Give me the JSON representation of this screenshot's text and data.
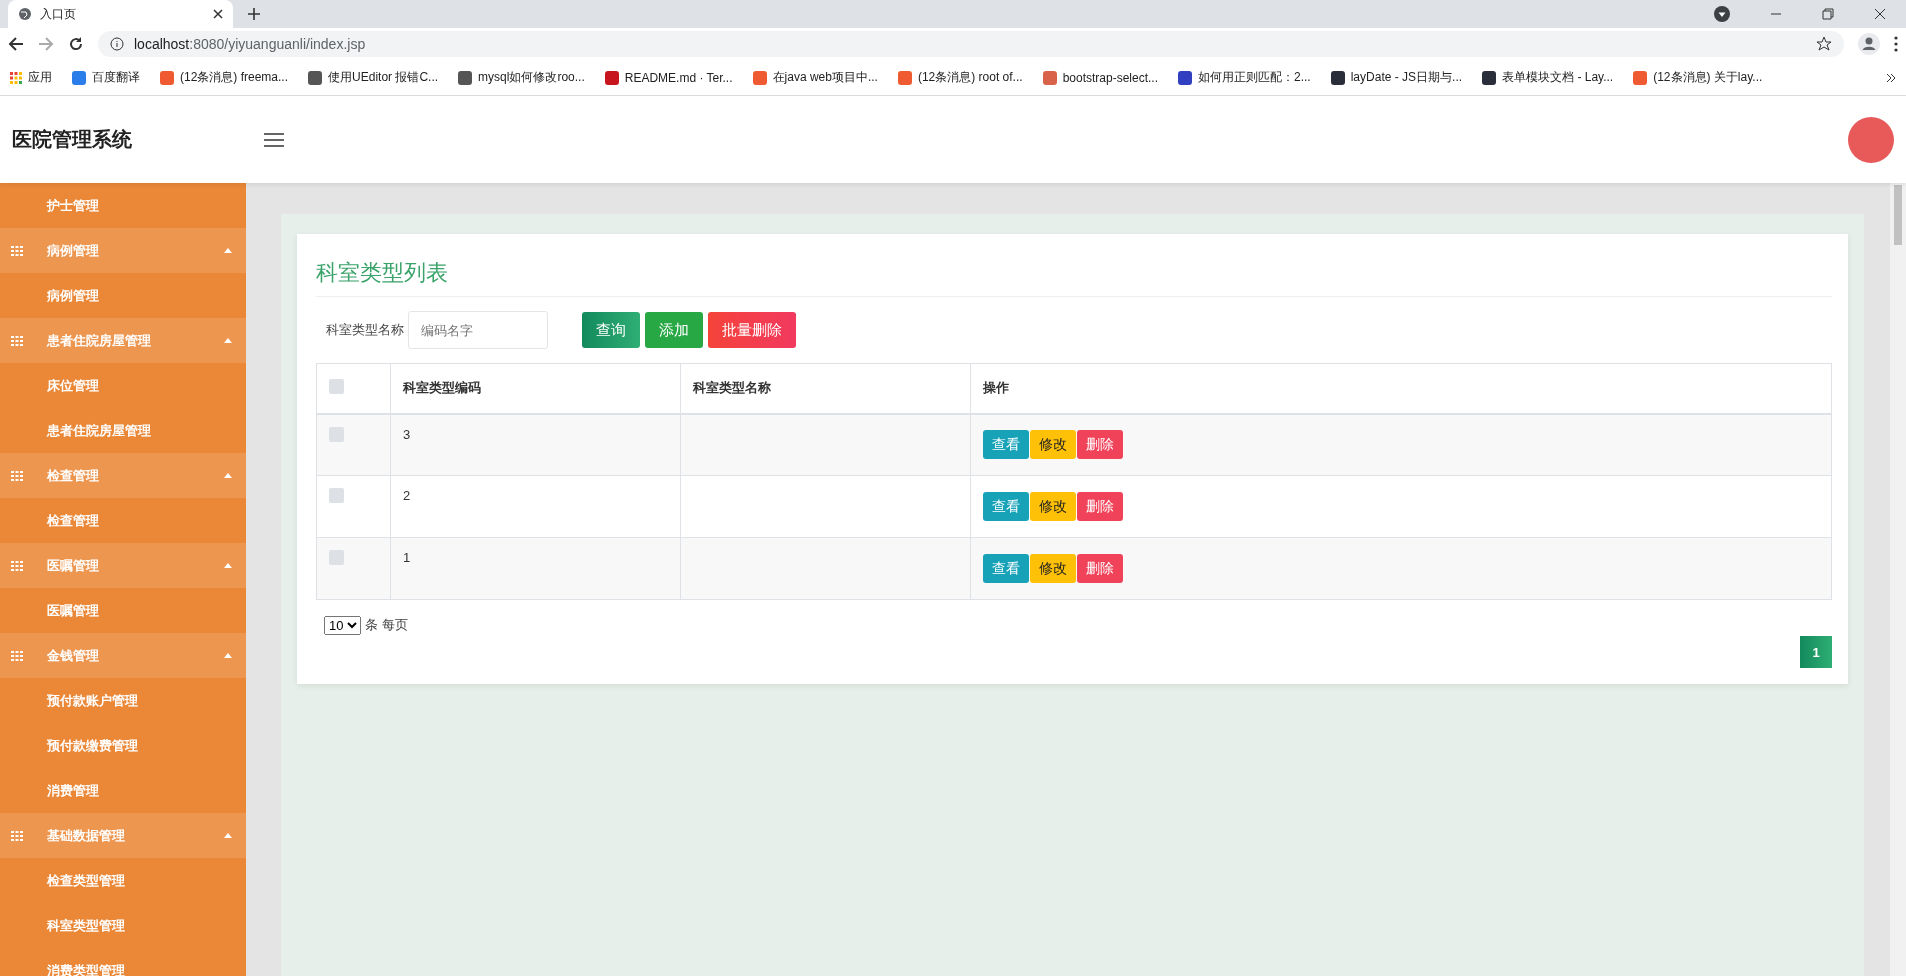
{
  "browser": {
    "tab_title": "入口页",
    "url_host": "localhost",
    "url_rest": ":8080/yiyuanguanli/index.jsp",
    "apps_label": "应用",
    "bookmarks": [
      {
        "label": "百度翻译",
        "color": "#2b7de9"
      },
      {
        "label": "(12条消息) freema...",
        "color": "#f05a30"
      },
      {
        "label": "使用UEditor 报错C...",
        "color": "#555555"
      },
      {
        "label": "mysql如何修改roo...",
        "color": "#555555"
      },
      {
        "label": "README.md · Ter...",
        "color": "#c7161e"
      },
      {
        "label": "在java web项目中...",
        "color": "#f05a30"
      },
      {
        "label": "(12条消息) root of...",
        "color": "#f05a30"
      },
      {
        "label": "bootstrap-select...",
        "color": "#d9634a"
      },
      {
        "label": "如何用正则匹配：2...",
        "color": "#3040c0"
      },
      {
        "label": "layDate - JS日期与...",
        "color": "#2a2e3a"
      },
      {
        "label": "表单模块文档 - Lay...",
        "color": "#2a2e3a"
      },
      {
        "label": "(12条消息) 关于lay...",
        "color": "#f05a30"
      }
    ]
  },
  "app": {
    "title": "医院管理系统"
  },
  "sidebar": {
    "items": [
      {
        "kind": "item",
        "label": "护士管理"
      },
      {
        "kind": "group",
        "label": "病例管理",
        "expanded": true,
        "children": [
          {
            "kind": "item",
            "label": "病例管理"
          }
        ]
      },
      {
        "kind": "group",
        "label": "患者住院房屋管理",
        "expanded": true,
        "children": [
          {
            "kind": "item",
            "label": "床位管理"
          },
          {
            "kind": "item",
            "label": "患者住院房屋管理"
          }
        ]
      },
      {
        "kind": "group",
        "label": "检查管理",
        "expanded": true,
        "children": [
          {
            "kind": "item",
            "label": "检查管理"
          }
        ]
      },
      {
        "kind": "group",
        "label": "医嘱管理",
        "expanded": true,
        "children": [
          {
            "kind": "item",
            "label": "医嘱管理"
          }
        ]
      },
      {
        "kind": "group",
        "label": "金钱管理",
        "expanded": true,
        "children": [
          {
            "kind": "item",
            "label": "预付款账户管理"
          },
          {
            "kind": "item",
            "label": "预付款缴费管理"
          },
          {
            "kind": "item",
            "label": "消费管理"
          }
        ]
      },
      {
        "kind": "group",
        "label": "基础数据管理",
        "expanded": true,
        "children": [
          {
            "kind": "item",
            "label": "检查类型管理"
          },
          {
            "kind": "item",
            "label": "科室类型管理"
          },
          {
            "kind": "item",
            "label": "消费类型管理"
          }
        ]
      }
    ]
  },
  "card": {
    "title": "科室类型列表",
    "search": {
      "label": "科室类型名称",
      "placeholder": "编码名字"
    },
    "buttons": [
      {
        "kind": "query",
        "label": "查询"
      },
      {
        "kind": "add",
        "label": "添加"
      },
      {
        "kind": "bulk-delete",
        "label": "批量删除"
      }
    ],
    "table": {
      "header_checked": false,
      "columns": [
        "科室类型编码",
        "科室类型名称",
        "操作"
      ],
      "rows": [
        {
          "checked": false,
          "code": "3",
          "actions": [
            "查看",
            "修改",
            "删除"
          ]
        },
        {
          "checked": false,
          "code": "2",
          "actions": [
            "查看",
            "修改",
            "删除"
          ]
        },
        {
          "checked": false,
          "code": "1",
          "actions": [
            "查看",
            "修改",
            "删除"
          ]
        }
      ]
    },
    "page_size": "10",
    "page_size_label": "条 每页",
    "pages": [
      {
        "label": "1",
        "selected": true
      }
    ]
  }
}
